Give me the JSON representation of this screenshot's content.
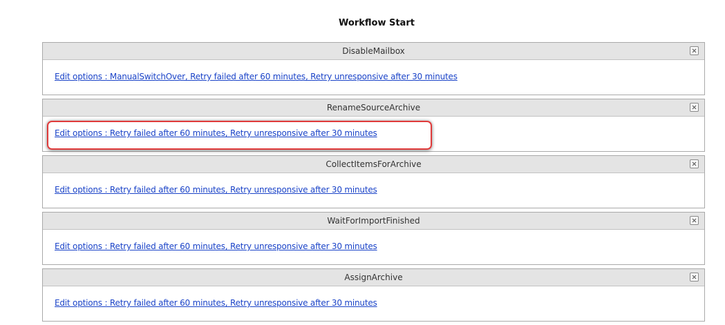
{
  "page_title": "Workflow Start",
  "close_icon_name": "close-icon",
  "steps": [
    {
      "name": "DisableMailbox",
      "options_text": "Edit options : ManualSwitchOver, Retry failed after 60 minutes, Retry unresponsive after 30 minutes"
    },
    {
      "name": "RenameSourceArchive",
      "options_text": "Edit options : Retry failed after 60 minutes, Retry unresponsive after 30 minutes"
    },
    {
      "name": "CollectItemsForArchive",
      "options_text": "Edit options : Retry failed after 60 minutes, Retry unresponsive after 30 minutes"
    },
    {
      "name": "WaitForImportFinished",
      "options_text": "Edit options : Retry failed after 60 minutes, Retry unresponsive after 30 minutes"
    },
    {
      "name": "AssignArchive",
      "options_text": "Edit options : Retry failed after 60 minutes, Retry unresponsive after 30 minutes"
    }
  ],
  "colors": {
    "link": "#1a43c8",
    "header_bg": "#e4e4e4",
    "border": "#a9a9a9",
    "highlight": "#e03a3a"
  }
}
